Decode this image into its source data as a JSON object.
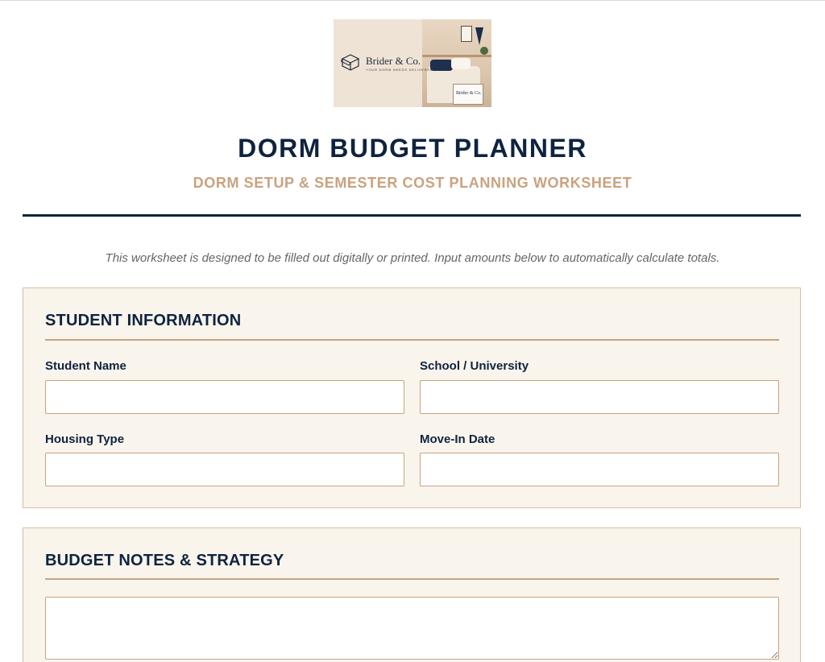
{
  "logo": {
    "brand": "Brider & Co.",
    "tagline": "YOUR DORM NEEDS DELIVERED",
    "box_label": "Brider & Co."
  },
  "header": {
    "title": "DORM BUDGET PLANNER",
    "subtitle": "DORM SETUP & SEMESTER COST PLANNING WORKSHEET"
  },
  "intro": "This worksheet is designed to be filled out digitally or printed. Input amounts below to automatically calculate totals.",
  "student_information": {
    "heading": "STUDENT INFORMATION",
    "fields": {
      "student_name": {
        "label": "Student Name",
        "value": ""
      },
      "school": {
        "label": "School / University",
        "value": ""
      },
      "housing_type": {
        "label": "Housing Type",
        "value": ""
      },
      "move_in_date": {
        "label": "Move-In Date",
        "value": ""
      }
    }
  },
  "budget_notes": {
    "heading": "BUDGET NOTES & STRATEGY",
    "value": ""
  },
  "colors": {
    "navy": "#0f2340",
    "gold": "#c9a27e",
    "panel": "#f9f4ec"
  }
}
